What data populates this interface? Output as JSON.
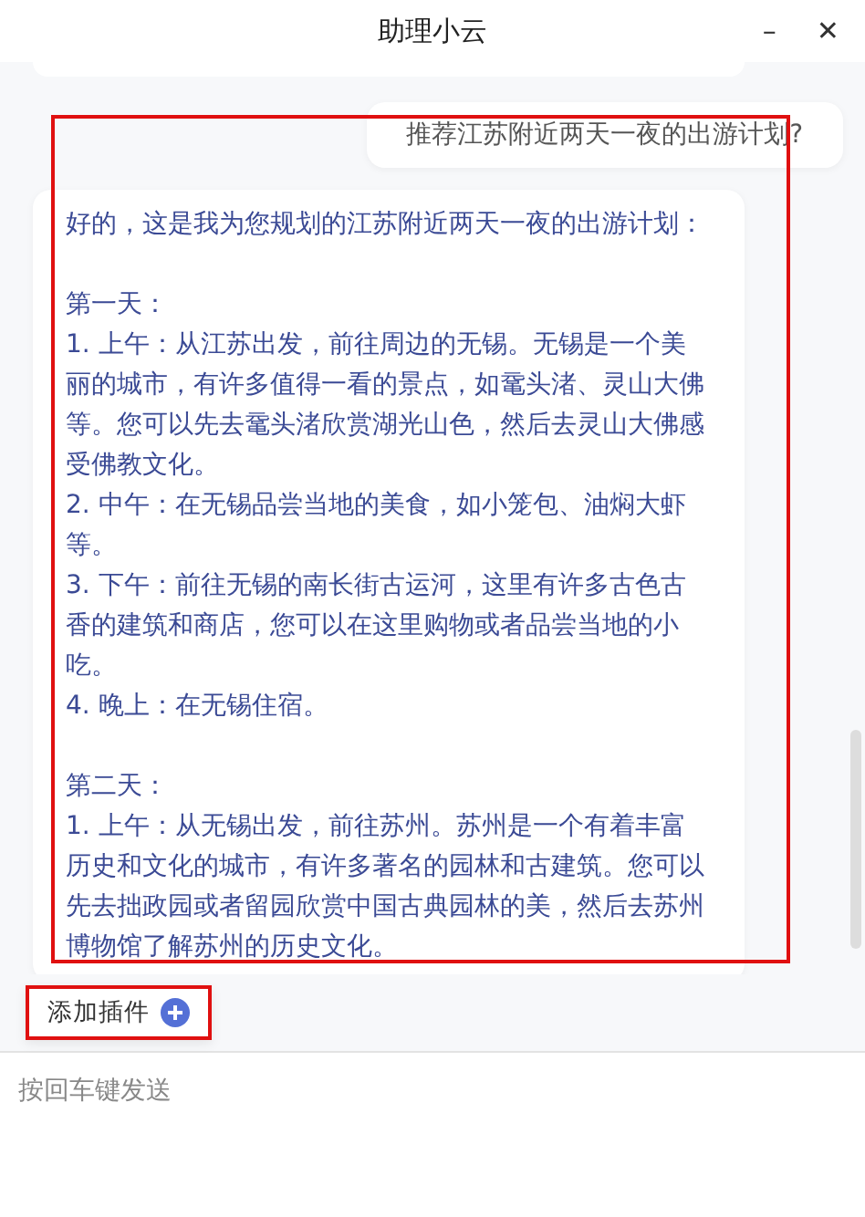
{
  "window": {
    "title": "助理小云",
    "controls": [
      "–",
      "✕"
    ]
  },
  "messages": [
    {
      "kind": "user",
      "sections": [
        [
          "推荐江苏附近两天一夜的出游计划?"
        ]
      ]
    },
    {
      "kind": "assistant",
      "sections": [
        [
          "好的，这是我为您规划的江苏附近两天一夜的出游计划："
        ],
        [
          "第一天：",
          "1. 上午：从江苏出发，前往周边的无锡。无锡是一个美",
          "丽的城市，有许多值得一看的景点，如鼋头渚、灵山大佛",
          "等。您可以先去鼋头渚欣赏湖光山色，然后去灵山大佛感",
          "受佛教文化。",
          "2. 中午：在无锡品尝当地的美食，如小笼包、油焖大虾",
          "等。",
          "3. 下午：前往无锡的南长街古运河，这里有许多古色古",
          "香的建筑和商店，您可以在这里购物或者品尝当地的小",
          "吃。",
          "4. 晚上：在无锡住宿。"
        ],
        [
          "第二天：",
          "1. 上午：从无锡出发，前往苏州。苏州是一个有着丰富",
          "历史和文化的城市，有许多著名的园林和古建筑。您可以",
          "先去拙政园或者留园欣赏中国古典园林的美，然后去苏州",
          "博物馆了解苏州的历史文化。"
        ]
      ]
    }
  ],
  "plugin_button": {
    "label": "添加插件"
  },
  "input": {
    "placeholder": "按回车键发送"
  }
}
